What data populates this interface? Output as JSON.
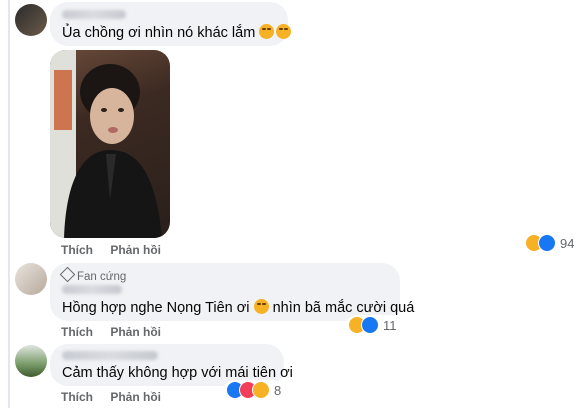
{
  "comments": [
    {
      "text": "Ủa chồng ơi nhìn nó khác lắm",
      "actions": {
        "like": "Thích",
        "reply": "Phản hồi"
      },
      "reactions": {
        "icons": [
          "haha",
          "like"
        ],
        "count": "94"
      }
    },
    {
      "badge": "Fan cứng",
      "text_before": "Hồng hợp nghe Nọng Tiên ơi",
      "text_after": "nhìn bã mắc cười quá",
      "actions": {
        "like": "Thích",
        "reply": "Phản hồi"
      },
      "reactions": {
        "icons": [
          "haha",
          "like"
        ],
        "count": "11"
      }
    },
    {
      "text": "Cảm thấy không hợp với mái tiên ơi",
      "actions": {
        "like": "Thích",
        "reply": "Phản hồi"
      },
      "reactions": {
        "icons": [
          "like",
          "love",
          "care"
        ],
        "count": "8"
      }
    }
  ]
}
